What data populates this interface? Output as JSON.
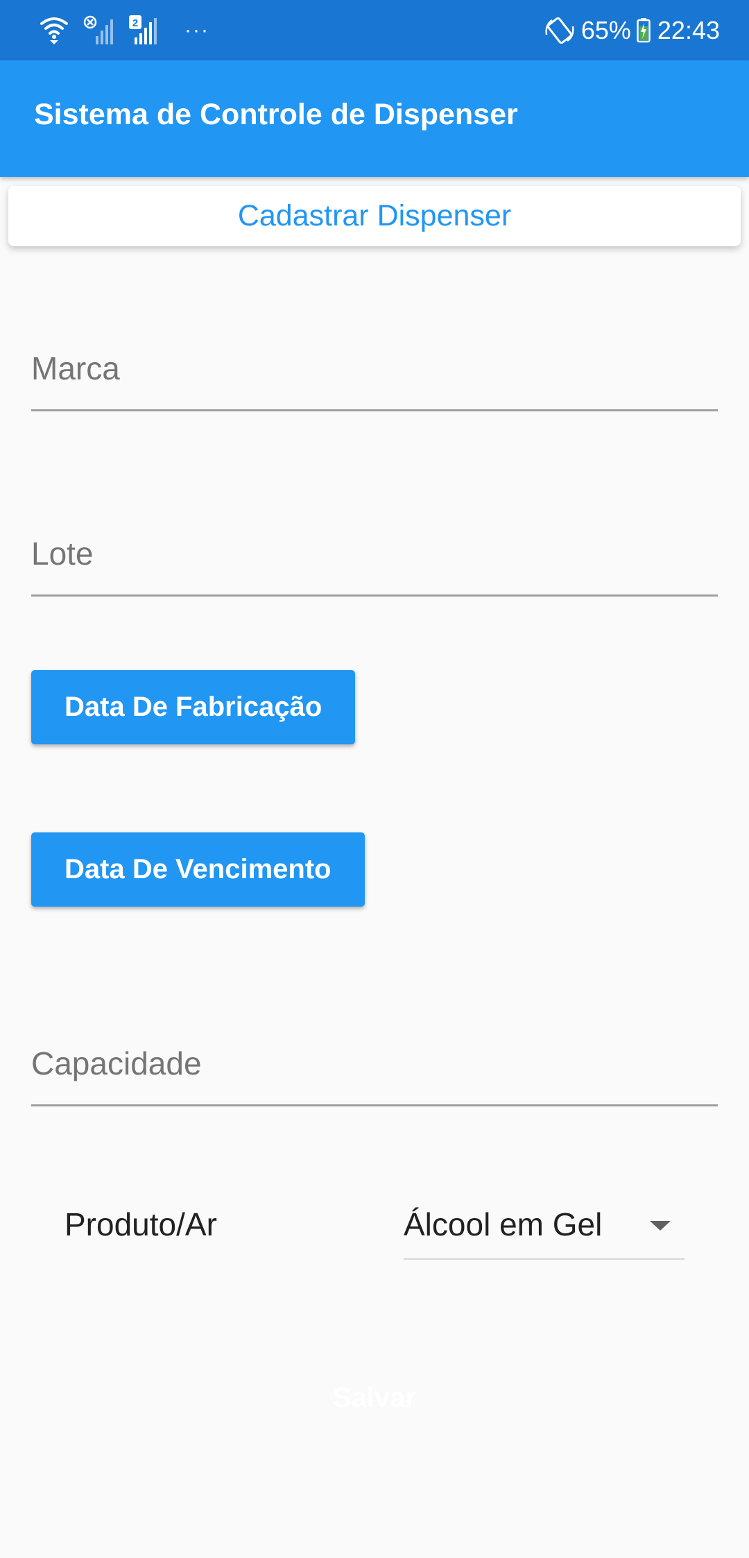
{
  "status_bar": {
    "sim2_badge": "2",
    "more": "···",
    "battery": "65%",
    "time": "22:43",
    "icons": [
      "wifi-icon",
      "signal-disabled-icon",
      "signal-sim2-icon",
      "rotate-icon",
      "battery-charging-icon"
    ]
  },
  "app_bar": {
    "title": "Sistema de Controle de Dispenser"
  },
  "register_tab": {
    "label": "Cadastrar Dispenser"
  },
  "form": {
    "marca_label": "Marca",
    "lote_label": "Lote",
    "fabricacao_button": "Data De Fabricação",
    "vencimento_button": "Data De Vencimento",
    "capacidade_label": "Capacidade",
    "produto_label": "Produto/Ar",
    "produto_selected": "Álcool em Gel",
    "save_button": "Salvar"
  },
  "colors": {
    "status_bar": "#1976d2",
    "primary": "#2196f3",
    "background": "#fafafa",
    "hint_text": "#757575",
    "underline": "#9e9e9e",
    "battery_green": "#4caf50"
  }
}
